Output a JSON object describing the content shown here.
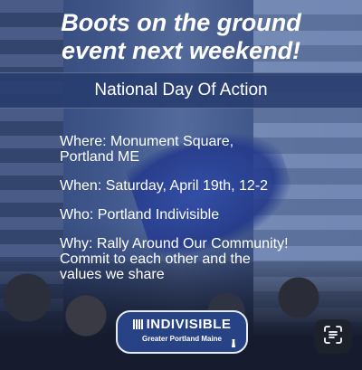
{
  "poster": {
    "headline_line1": "Boots on the ground",
    "headline_line2": "event next weekend!",
    "banner": "National Day Of Action",
    "where": "Where: Monument Square,\nPortland ME",
    "when": "When: Saturday, April 19th, 12-2",
    "who": "Who: Portland Indivisible",
    "why": "Why: Rally Around Our Community!\nCommit to each other and the\nvalues we share"
  },
  "logo": {
    "name": "INDIVISIBLE",
    "subtitle": "Greater Portland Maine"
  },
  "icons": {
    "scan": "text-scan-icon",
    "lighthouse": "lighthouse-icon"
  }
}
